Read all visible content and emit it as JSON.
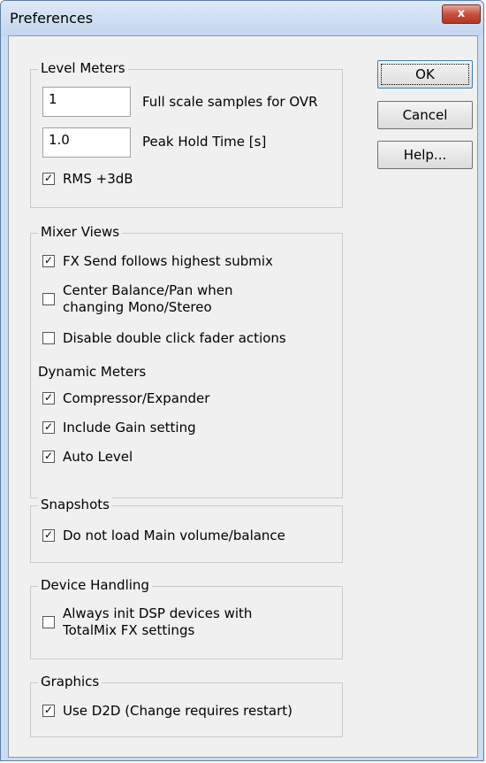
{
  "window": {
    "title": "Preferences",
    "close_label": "x"
  },
  "buttons": {
    "ok": "OK",
    "cancel": "Cancel",
    "help": "Help..."
  },
  "level_meters": {
    "label": "Level Meters",
    "ovr_value": "1",
    "ovr_label": "Full scale samples for OVR",
    "peak_value": "1.0",
    "peak_label": "Peak Hold Time [s]",
    "rms": {
      "label": "RMS +3dB",
      "checked": true
    }
  },
  "mixer_views": {
    "label": "Mixer Views",
    "fx_send": {
      "label": "FX Send follows highest submix",
      "checked": true
    },
    "center_balance": {
      "label_line1": "Center Balance/Pan when",
      "label_line2": "changing Mono/Stereo",
      "checked": false
    },
    "disable_double_click": {
      "label": "Disable double click fader actions",
      "checked": false
    },
    "dynamic_meters_label": "Dynamic Meters",
    "compressor": {
      "label": "Compressor/Expander",
      "checked": true
    },
    "include_gain": {
      "label": "Include Gain setting",
      "checked": true
    },
    "auto_level": {
      "label": "Auto Level",
      "checked": true
    }
  },
  "snapshots": {
    "label": "Snapshots",
    "no_main_volume": {
      "label": "Do not load Main volume/balance",
      "checked": true
    }
  },
  "device_handling": {
    "label": "Device Handling",
    "always_init": {
      "label_line1": "Always init DSP devices with",
      "label_line2": "TotalMix FX settings",
      "checked": false
    }
  },
  "graphics": {
    "label": "Graphics",
    "use_d2d": {
      "label": "Use D2D (Change requires restart)",
      "checked": true
    }
  }
}
